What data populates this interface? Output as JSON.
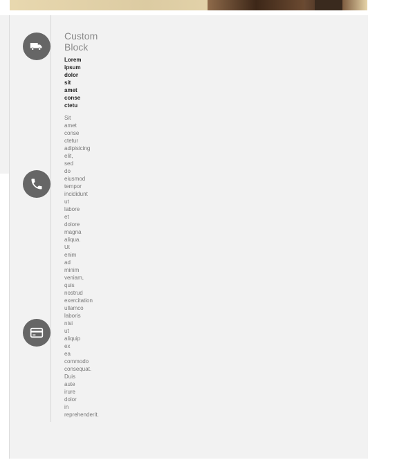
{
  "block": {
    "title": "Custom Block",
    "subtitle": "Lorem ipsum dolor sit amet conse ctetu",
    "body": "Sit amet conse ctetur adipisicing elit, sed do eiusmod tempor incididunt ut labore et dolore magna aliqua. Ut enim ad minim veniam, quis nostrud exercitation ullamco laboris nisi ut aliquip ex ea commodo consequat. Duis aute irure dolor in reprehenderit."
  },
  "icons": [
    "truck-icon",
    "phone-icon",
    "credit-card-icon"
  ],
  "colors": {
    "panel_bg": "#f2f2f2",
    "icon_circle": "#666666",
    "title_text": "#8a8a8a",
    "subtitle_text": "#222222",
    "body_text": "#777777"
  }
}
